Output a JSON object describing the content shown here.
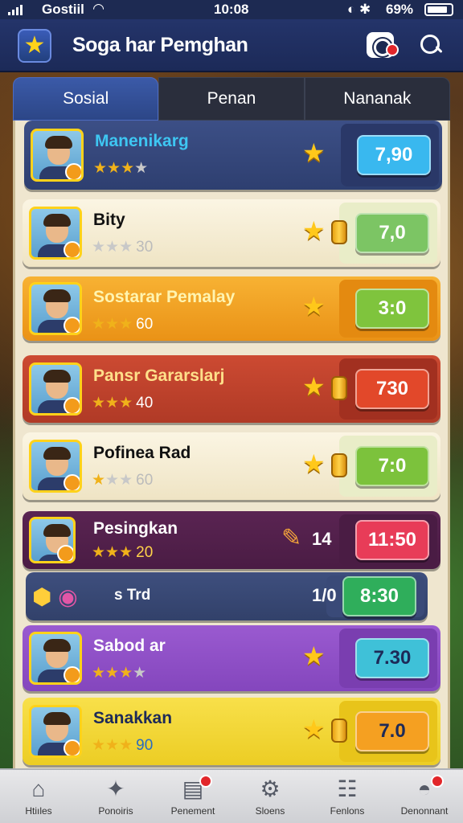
{
  "status_bar": {
    "carrier": "Gostiil",
    "time": "10:08",
    "battery_pct": "69%"
  },
  "header": {
    "title": "Soga har Pemghan"
  },
  "tabs": [
    {
      "label": "Sosial",
      "active": true
    },
    {
      "label": "Penan",
      "active": false
    },
    {
      "label": "Nananak",
      "active": false
    }
  ],
  "rows": [
    {
      "name": "Manenikarg",
      "stars": 3,
      "rating_num": "",
      "button": "7,90",
      "btn_color": "#39b8ef",
      "theme": "blue"
    },
    {
      "name": "Bity",
      "stars": 0,
      "rating_num": "30",
      "button": "7,0",
      "btn_color": "#7cc564",
      "theme": "cream"
    },
    {
      "name": "Sostarar Pemalay",
      "stars": 3,
      "rating_num": "60",
      "button": "3:0",
      "btn_color": "#7fc43d",
      "theme": "orange"
    },
    {
      "name": "Pansr Gararslarj",
      "stars": 3,
      "rating_num": "40",
      "button": "730",
      "btn_color": "#e2482a",
      "theme": "red"
    },
    {
      "name": "Pofinea Rad",
      "stars": 1,
      "rating_num": "60",
      "button": "7:0",
      "btn_color": "#7cc23c",
      "theme": "cream"
    },
    {
      "name": "Pesingkan",
      "stars": 3,
      "rating_num": "20",
      "side_value": "14",
      "button": "11:50",
      "btn_color": "#e83c58",
      "theme": "purple-dark"
    },
    {
      "name": "s Trd",
      "stars": 0,
      "rating_num": "",
      "side_value": "1/0",
      "button": "8:30",
      "btn_color": "#2fae5b",
      "theme": "navy"
    },
    {
      "name": "Sabod ar",
      "stars": 3,
      "rating_num": "",
      "button": "7.30",
      "btn_color": "#3fc1d8",
      "theme": "violet"
    },
    {
      "name": "Sanakkan",
      "stars": 3,
      "rating_num": "90",
      "button": "7.0",
      "btn_color": "#f5a021",
      "theme": "yellow"
    }
  ],
  "bottom_nav": [
    {
      "label": "Htiıles",
      "icon": "home-icon",
      "badge": false
    },
    {
      "label": "Ponoiris",
      "icon": "puzzle-icon",
      "badge": false
    },
    {
      "label": "Penement",
      "icon": "chest-icon",
      "badge": true
    },
    {
      "label": "Sloens",
      "icon": "gear-icon",
      "badge": false
    },
    {
      "label": "Fenlons",
      "icon": "news-icon",
      "badge": false
    },
    {
      "label": "Denonnant",
      "icon": "chat-icon",
      "badge": true
    }
  ]
}
